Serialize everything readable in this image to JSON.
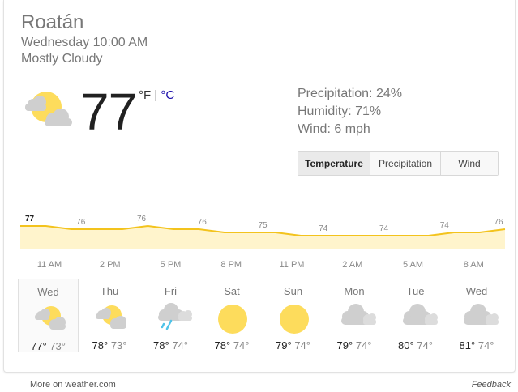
{
  "location": "Roatán",
  "datetime": "Wednesday 10:00 AM",
  "condition": "Mostly Cloudy",
  "current": {
    "temp": "77",
    "unit_f": "°F",
    "unit_sep": " | ",
    "unit_c": "°C",
    "icon": "partly-cloudy-icon"
  },
  "stats": {
    "precipitation": "Precipitation: 24%",
    "humidity": "Humidity: 71%",
    "wind": "Wind: 6 mph"
  },
  "tabs": [
    "Temperature",
    "Precipitation",
    "Wind"
  ],
  "active_tab": "Temperature",
  "colors": {
    "line": "#f3c31d",
    "fill": "#fff4cc",
    "sun": "#fddc5c",
    "cloud": "#cfcfcf",
    "rain": "#4fc3e8"
  },
  "chart_data": {
    "type": "area",
    "x": [
      "11 AM",
      "2 PM",
      "5 PM",
      "8 PM",
      "11 PM",
      "2 AM",
      "5 AM",
      "8 AM",
      ""
    ],
    "labels": [
      "77",
      "76",
      "76",
      "76",
      "75",
      "74",
      "74",
      "74",
      "76"
    ],
    "values": [
      77,
      77,
      76,
      76,
      76,
      77,
      76,
      76,
      75,
      75,
      75,
      74,
      74,
      74,
      74,
      74,
      74,
      75,
      75,
      76
    ],
    "ylim": [
      70,
      78
    ]
  },
  "forecast": [
    {
      "day": "Wed",
      "hi": "77°",
      "lo": "73°",
      "icon": "partly-cloudy-icon"
    },
    {
      "day": "Thu",
      "hi": "78°",
      "lo": "73°",
      "icon": "partly-cloudy-icon"
    },
    {
      "day": "Fri",
      "hi": "78°",
      "lo": "74°",
      "icon": "rain-icon"
    },
    {
      "day": "Sat",
      "hi": "78°",
      "lo": "74°",
      "icon": "sun-icon"
    },
    {
      "day": "Sun",
      "hi": "79°",
      "lo": "74°",
      "icon": "sun-icon"
    },
    {
      "day": "Mon",
      "hi": "79°",
      "lo": "74°",
      "icon": "cloudy-icon"
    },
    {
      "day": "Tue",
      "hi": "80°",
      "lo": "74°",
      "icon": "cloudy-icon"
    },
    {
      "day": "Wed",
      "hi": "81°",
      "lo": "74°",
      "icon": "cloudy-icon"
    }
  ],
  "footer": {
    "source": "More on weather.com",
    "feedback": "Feedback"
  }
}
